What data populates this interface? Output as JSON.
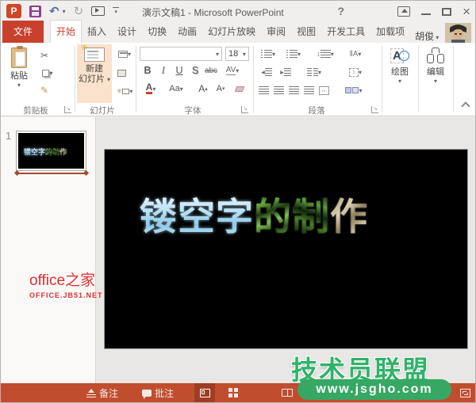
{
  "titlebar": {
    "title": "演示文稿1 - Microsoft PowerPoint"
  },
  "tabs": {
    "file": "文件",
    "items": [
      {
        "label": "开始",
        "active": true
      },
      {
        "label": "插入",
        "active": false
      },
      {
        "label": "设计",
        "active": false
      },
      {
        "label": "切换",
        "active": false
      },
      {
        "label": "动画",
        "active": false
      },
      {
        "label": "幻灯片放映",
        "active": false
      },
      {
        "label": "审阅",
        "active": false
      },
      {
        "label": "视图",
        "active": false
      },
      {
        "label": "开发工具",
        "active": false
      },
      {
        "label": "加载项",
        "active": false
      }
    ],
    "user": "胡俊"
  },
  "ribbon": {
    "clipboard": {
      "label": "剪贴板",
      "paste": "粘贴"
    },
    "slides": {
      "label": "幻灯片",
      "new_slide_line1": "新建",
      "new_slide_line2": "幻灯片"
    },
    "font": {
      "label": "字体",
      "size": "18",
      "bold": "B",
      "italic": "I",
      "underline": "U",
      "strike": "S",
      "abc": "abc",
      "av": "AV",
      "color_a": "A",
      "aa": "Aa",
      "grow": "A",
      "shrink": "A"
    },
    "paragraph": {
      "label": "段落"
    },
    "drawing": {
      "label": "绘图",
      "letter": "A"
    },
    "editing": {
      "label": "编辑"
    }
  },
  "icons": {
    "scissors": "✂",
    "undo": "↶",
    "redo": "↻",
    "caret_down": "▾",
    "caret_up": "▴",
    "close": "×",
    "help": "?",
    "launcher_arrow": "↘",
    "brush": "✎",
    "arrows_updown": "↕",
    "left_tri": "◂",
    "right_tri": "▸",
    "arrows_lr": "↔"
  },
  "slide_panel": {
    "number": "1"
  },
  "slide": {
    "chars": [
      {
        "ch": "镂",
        "tex": "blue"
      },
      {
        "ch": "空",
        "tex": "blue"
      },
      {
        "ch": "字",
        "tex": "blue"
      },
      {
        "ch": "的",
        "tex": "green"
      },
      {
        "ch": "制",
        "tex": "green2"
      },
      {
        "ch": "作",
        "tex": "stone"
      }
    ]
  },
  "watermarks": {
    "left_line1": "office之家",
    "left_line2": "OFFICE.JB51.NET",
    "right_title": "技术员联盟",
    "right_url": "www.jsgho.com"
  },
  "statusbar": {
    "notes": "备注",
    "comments": "批注"
  },
  "colors": {
    "accent_red": "#C9402C",
    "status_red": "#C14D2F",
    "wm_green": "#36A863",
    "slide_bg": "#000000"
  }
}
